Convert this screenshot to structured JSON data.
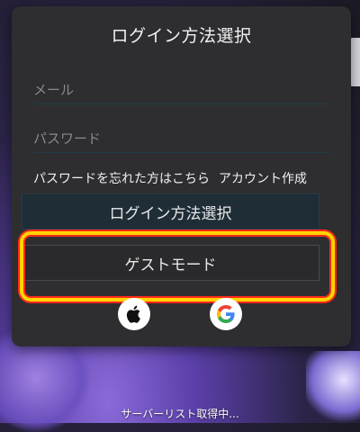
{
  "login_panel": {
    "title": "ログイン方法選択",
    "mail_placeholder": "メール",
    "password_placeholder": "パスワード",
    "forgot_password_link": "パスワードを忘れた方はこちら",
    "create_account_link": "アカウント作成",
    "login_method_button": "ログイン方法選択",
    "guest_mode_button": "ゲストモード"
  },
  "social_login": {
    "apple_icon": "apple-logo",
    "google_icon": "google-logo"
  },
  "status": {
    "text": "サーバーリスト取得中..."
  },
  "highlight_color": "#ffd400"
}
